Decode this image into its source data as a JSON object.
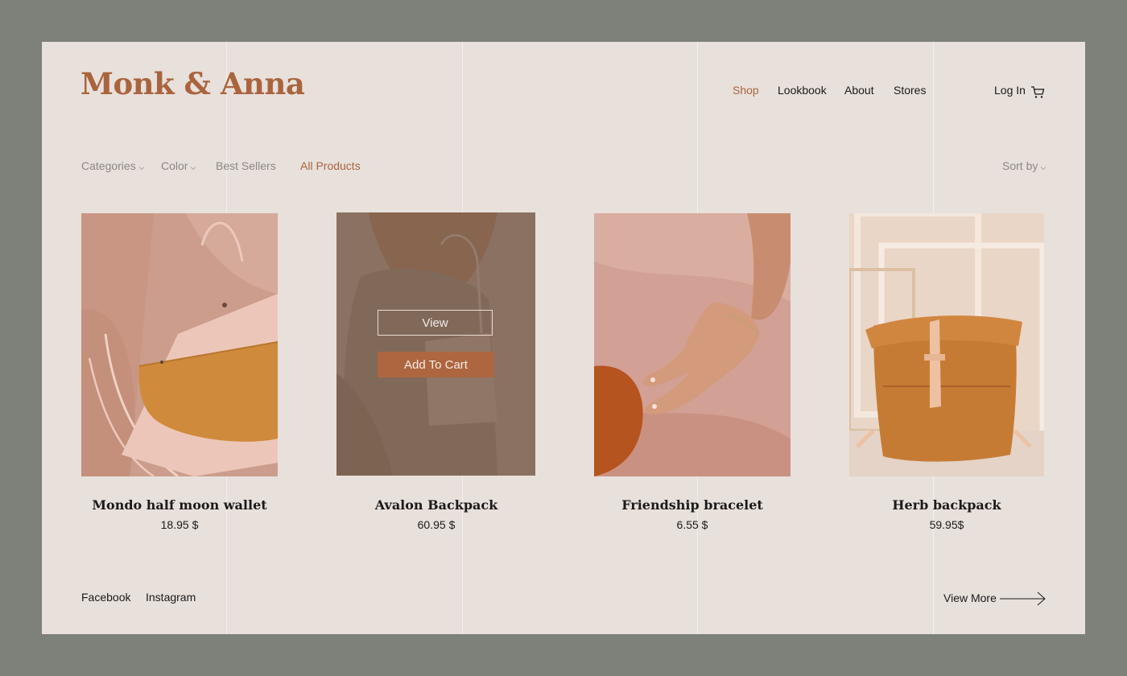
{
  "brand": {
    "name": "Monk & Anna",
    "accent_color": "#a9643e"
  },
  "nav": {
    "items": [
      {
        "label": "Shop",
        "active": true
      },
      {
        "label": "Lookbook",
        "active": false
      },
      {
        "label": "About",
        "active": false
      },
      {
        "label": "Stores",
        "active": false
      }
    ],
    "login_label": "Log In",
    "cart_icon": "shopping-cart-icon"
  },
  "filters": {
    "categories_label": "Categories",
    "color_label": "Color",
    "best_sellers_label": "Best Sellers",
    "all_products_label": "All Products",
    "sort_label": "Sort by"
  },
  "products": [
    {
      "name": "Mondo half moon wallet",
      "price": "18.95 $"
    },
    {
      "name": "Avalon Backpack",
      "price": "60.95 $",
      "hover": true,
      "view_label": "View",
      "add_to_cart_label": "Add To Cart"
    },
    {
      "name": "Friendship bracelet",
      "price": "6.55 $"
    },
    {
      "name": "Herb backpack",
      "price": "59.95$"
    }
  ],
  "footer": {
    "facebook_label": "Facebook",
    "instagram_label": "Instagram",
    "view_more_label": "View More",
    "arrow_icon": "arrow-right-icon"
  }
}
